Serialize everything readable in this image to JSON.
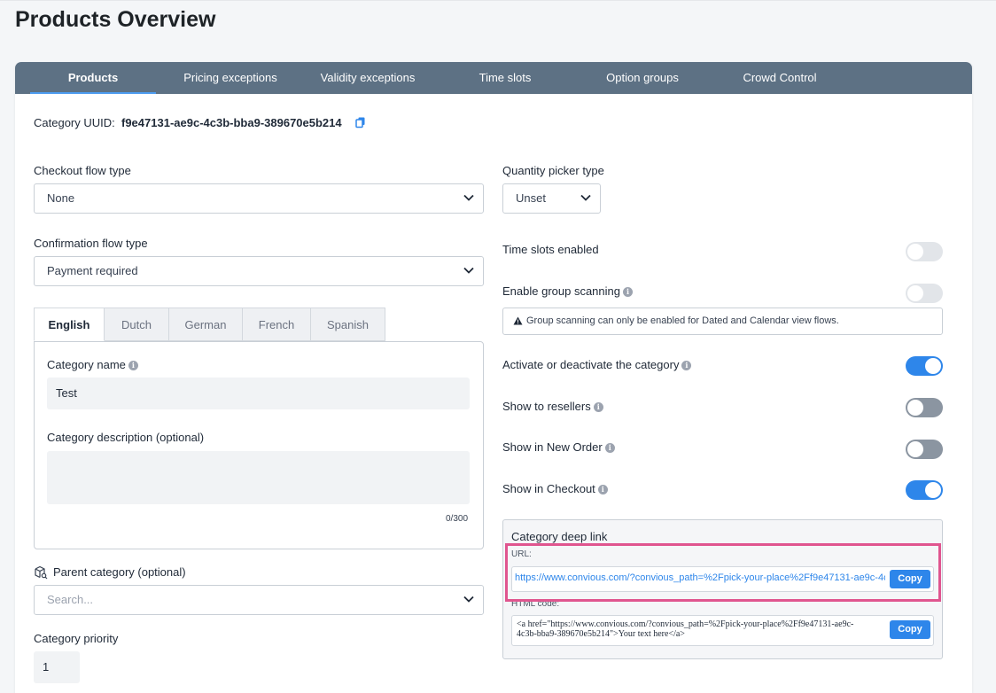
{
  "page": {
    "title": "Products Overview"
  },
  "tabs": [
    {
      "label": "Products"
    },
    {
      "label": "Pricing exceptions"
    },
    {
      "label": "Validity exceptions"
    },
    {
      "label": "Time slots"
    },
    {
      "label": "Option groups"
    },
    {
      "label": "Crowd Control"
    }
  ],
  "uuid": {
    "label": "Category UUID:",
    "value": "f9e47131-ae9c-4c3b-bba9-389670e5b214"
  },
  "checkout_flow": {
    "label": "Checkout flow type",
    "value": "None"
  },
  "confirmation_flow": {
    "label": "Confirmation flow type",
    "value": "Payment required"
  },
  "quantity_picker": {
    "label": "Quantity picker type",
    "value": "Unset"
  },
  "languages": [
    "English",
    "Dutch",
    "German",
    "French",
    "Spanish"
  ],
  "category_name": {
    "label": "Category name",
    "value": "Test"
  },
  "category_description": {
    "label": "Category description (optional)",
    "value": "",
    "counter": "0/300"
  },
  "parent_category": {
    "label": "Parent category (optional)",
    "placeholder": "Search..."
  },
  "priority": {
    "label": "Category priority",
    "value": "1"
  },
  "toggles": {
    "time_slots": {
      "label": "Time slots enabled"
    },
    "group_scanning": {
      "label": "Enable group scanning",
      "warning": "Group scanning can only be enabled for Dated and Calendar view flows."
    },
    "activate": {
      "label": "Activate or deactivate the category"
    },
    "resellers": {
      "label": "Show to resellers"
    },
    "new_order": {
      "label": "Show in New Order"
    },
    "checkout": {
      "label": "Show in Checkout"
    }
  },
  "deep_link": {
    "title": "Category deep link",
    "url_label": "URL:",
    "url": "https://www.convious.com/?convious_path=%2Fpick-your-place%2Ff9e47131-ae9c-4c...",
    "html_label": "HTML code:",
    "html_line1": "<a href=\"https://www.convious.com/?convious_path=%2Fpick-your-place%2Ff9e47131-ae9c-",
    "html_line2": "4c3b-bba9-389670e5b214\">Your text here</a>",
    "copy_label": "Copy"
  },
  "colors": {
    "tab_bar": "#5d7184",
    "accent": "#2e86ea",
    "highlight": "#e0558f"
  }
}
